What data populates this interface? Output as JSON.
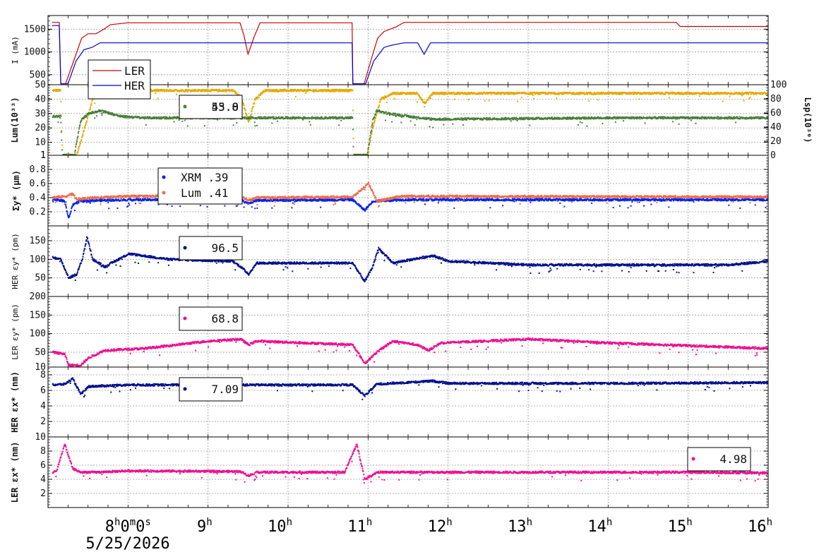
{
  "chart_data": [
    {
      "type": "line",
      "panel": "current",
      "ylabel": "I (mA)",
      "ylim": [
        280,
        1800
      ],
      "yticks": [
        500,
        1000,
        1500
      ],
      "grid": true,
      "legend": {
        "placement": "bottom-left",
        "entries": [
          "LER",
          "HER"
        ]
      },
      "series": [
        {
          "name": "LER",
          "color": "#cc0000",
          "points": [
            [
              7.05,
              1650
            ],
            [
              7.14,
              1650
            ],
            [
              7.16,
              300
            ],
            [
              7.22,
              300
            ],
            [
              7.32,
              800
            ],
            [
              7.42,
              1300
            ],
            [
              7.5,
              1400
            ],
            [
              7.6,
              1400
            ],
            [
              7.7,
              1500
            ],
            [
              7.78,
              1600
            ],
            [
              8.0,
              1640
            ],
            [
              9.4,
              1640
            ],
            [
              9.45,
              1350
            ],
            [
              9.5,
              950
            ],
            [
              9.58,
              1350
            ],
            [
              9.65,
              1640
            ],
            [
              10.8,
              1640
            ],
            [
              10.81,
              300
            ],
            [
              10.95,
              300
            ],
            [
              11.05,
              900
            ],
            [
              11.12,
              1300
            ],
            [
              11.2,
              1450
            ],
            [
              11.35,
              1550
            ],
            [
              11.45,
              1650
            ],
            [
              14.85,
              1650
            ],
            [
              14.9,
              1560
            ],
            [
              16.0,
              1560
            ]
          ]
        },
        {
          "name": "HER",
          "color": "#0000cc",
          "points": [
            [
              7.05,
              1580
            ],
            [
              7.14,
              1580
            ],
            [
              7.16,
              300
            ],
            [
              7.25,
              300
            ],
            [
              7.35,
              800
            ],
            [
              7.45,
              1050
            ],
            [
              7.55,
              1100
            ],
            [
              7.65,
              1200
            ],
            [
              10.8,
              1200
            ],
            [
              10.81,
              300
            ],
            [
              10.97,
              300
            ],
            [
              11.07,
              800
            ],
            [
              11.2,
              1100
            ],
            [
              11.3,
              1150
            ],
            [
              11.45,
              1200
            ],
            [
              11.62,
              1200
            ],
            [
              11.7,
              950
            ],
            [
              11.78,
              1200
            ],
            [
              16.0,
              1200
            ]
          ]
        }
      ]
    },
    {
      "type": "scatter",
      "panel": "luminosity",
      "ylabel": "Lum(10³³)",
      "ylabel_right": "Lsp(10³⁰)",
      "ylim": [
        1,
        50
      ],
      "yticks": [
        1,
        10,
        20,
        30,
        40,
        50
      ],
      "y2lim": [
        0,
        100
      ],
      "y2ticks": [
        0,
        20,
        40,
        60,
        80,
        100
      ],
      "grid": true,
      "legend": {
        "placement": "top-center",
        "values": [
          "55.0",
          "43.8"
        ]
      },
      "series": [
        {
          "color": "#e6a800",
          "points": [
            [
              7.05,
              46
            ],
            [
              7.15,
              46
            ],
            [
              7.17,
              1
            ],
            [
              7.35,
              1
            ],
            [
              7.45,
              20
            ],
            [
              7.55,
              40
            ],
            [
              7.7,
              45
            ],
            [
              8.0,
              46
            ],
            [
              9.3,
              46
            ],
            [
              9.4,
              42
            ],
            [
              9.5,
              24
            ],
            [
              9.58,
              40
            ],
            [
              9.7,
              46
            ],
            [
              10.8,
              46
            ],
            [
              10.81,
              1
            ],
            [
              10.98,
              1
            ],
            [
              11.05,
              20
            ],
            [
              11.15,
              40
            ],
            [
              11.3,
              44
            ],
            [
              11.6,
              44
            ],
            [
              11.7,
              37
            ],
            [
              11.8,
              44
            ],
            [
              16.0,
              44
            ]
          ]
        },
        {
          "color": "#4a7f3a",
          "points": [
            [
              7.05,
              28
            ],
            [
              7.15,
              28
            ],
            [
              7.17,
              1
            ],
            [
              7.32,
              1
            ],
            [
              7.4,
              25
            ],
            [
              7.5,
              30
            ],
            [
              7.65,
              32
            ],
            [
              7.9,
              28
            ],
            [
              8.2,
              27
            ],
            [
              10.8,
              27
            ],
            [
              10.81,
              1
            ],
            [
              10.98,
              1
            ],
            [
              11.05,
              25
            ],
            [
              11.1,
              32
            ],
            [
              11.25,
              30
            ],
            [
              11.5,
              28
            ],
            [
              11.8,
              26
            ],
            [
              14.0,
              27
            ],
            [
              16.0,
              27
            ]
          ]
        }
      ]
    },
    {
      "type": "scatter",
      "panel": "beam-size",
      "ylabel": "Σy* (μm)",
      "ylim": [
        0.0,
        1.0
      ],
      "yticks": [
        0.2,
        0.4,
        0.6,
        0.8,
        1.0
      ],
      "grid": true,
      "legend": {
        "placement": "top-center",
        "entries": [
          "XRM  .39",
          "Lum  .41"
        ]
      },
      "series": [
        {
          "name": "XRM",
          "color": "#0022ee",
          "points": [
            [
              7.05,
              0.38
            ],
            [
              7.2,
              0.35
            ],
            [
              7.25,
              0.1
            ],
            [
              7.3,
              0.3
            ],
            [
              7.4,
              0.35
            ],
            [
              7.6,
              0.36
            ],
            [
              8.0,
              0.37
            ],
            [
              9.4,
              0.37
            ],
            [
              9.5,
              0.32
            ],
            [
              9.6,
              0.36
            ],
            [
              10.8,
              0.37
            ],
            [
              10.95,
              0.22
            ],
            [
              11.05,
              0.35
            ],
            [
              11.4,
              0.37
            ],
            [
              16.0,
              0.37
            ]
          ]
        },
        {
          "name": "Lum",
          "color": "#f06a4a",
          "points": [
            [
              7.05,
              0.4
            ],
            [
              7.2,
              0.42
            ],
            [
              7.3,
              0.45
            ],
            [
              7.35,
              0.38
            ],
            [
              7.6,
              0.4
            ],
            [
              8.0,
              0.42
            ],
            [
              9.4,
              0.42
            ],
            [
              9.5,
              0.36
            ],
            [
              9.6,
              0.4
            ],
            [
              10.8,
              0.41
            ],
            [
              11.0,
              0.6
            ],
            [
              11.1,
              0.35
            ],
            [
              11.4,
              0.42
            ],
            [
              16.0,
              0.41
            ]
          ]
        }
      ]
    },
    {
      "type": "scatter",
      "panel": "her-emittance-y",
      "ylabel": "HER εy* (pm)",
      "ylim": [
        0,
        190
      ],
      "yticks": [
        50,
        100,
        150
      ],
      "grid": true,
      "legend": {
        "placement": "top-center",
        "values": [
          "96.5"
        ]
      },
      "series": [
        {
          "color": "#00108c",
          "points": [
            [
              7.05,
              105
            ],
            [
              7.15,
              100
            ],
            [
              7.25,
              50
            ],
            [
              7.35,
              60
            ],
            [
              7.42,
              100
            ],
            [
              7.48,
              160
            ],
            [
              7.55,
              100
            ],
            [
              7.7,
              80
            ],
            [
              8.0,
              115
            ],
            [
              8.5,
              100
            ],
            [
              9.3,
              95
            ],
            [
              9.4,
              80
            ],
            [
              9.5,
              60
            ],
            [
              9.6,
              90
            ],
            [
              10.8,
              90
            ],
            [
              10.95,
              40
            ],
            [
              11.05,
              80
            ],
            [
              11.12,
              130
            ],
            [
              11.3,
              90
            ],
            [
              11.8,
              110
            ],
            [
              12.0,
              95
            ],
            [
              13.0,
              85
            ],
            [
              14.5,
              85
            ],
            [
              15.5,
              85
            ],
            [
              16.0,
              95
            ]
          ]
        }
      ]
    },
    {
      "type": "scatter",
      "panel": "ler-emittance-y",
      "ylabel": "LER εy* (pm)",
      "ylim": [
        10,
        200
      ],
      "yticks": [
        10,
        50,
        100,
        150,
        200
      ],
      "grid": true,
      "legend": {
        "placement": "top-center",
        "values": [
          "68.8"
        ]
      },
      "series": [
        {
          "color": "#ee1090",
          "points": [
            [
              7.05,
              50
            ],
            [
              7.2,
              45
            ],
            [
              7.25,
              15
            ],
            [
              7.4,
              15
            ],
            [
              7.5,
              35
            ],
            [
              7.7,
              55
            ],
            [
              8.2,
              60
            ],
            [
              9.0,
              80
            ],
            [
              9.4,
              85
            ],
            [
              9.5,
              70
            ],
            [
              9.6,
              80
            ],
            [
              10.8,
              70
            ],
            [
              10.95,
              20
            ],
            [
              11.1,
              50
            ],
            [
              11.3,
              80
            ],
            [
              11.6,
              70
            ],
            [
              11.75,
              55
            ],
            [
              11.9,
              75
            ],
            [
              13.0,
              85
            ],
            [
              14.0,
              75
            ],
            [
              16.0,
              60
            ]
          ]
        }
      ]
    },
    {
      "type": "scatter",
      "panel": "her-emittance-x",
      "ylabel": "HER εx* (nm)",
      "ylim": [
        0,
        9
      ],
      "yticks": [
        2,
        4,
        6,
        8
      ],
      "grid": true,
      "legend": {
        "placement": "top-center",
        "values": [
          "7.09"
        ]
      },
      "series": [
        {
          "color": "#00108c",
          "points": [
            [
              7.05,
              6.7
            ],
            [
              7.2,
              6.8
            ],
            [
              7.3,
              7.5
            ],
            [
              7.4,
              5.5
            ],
            [
              7.5,
              6.5
            ],
            [
              8.0,
              6.7
            ],
            [
              10.8,
              6.7
            ],
            [
              10.95,
              5.3
            ],
            [
              11.1,
              6.8
            ],
            [
              11.8,
              7.2
            ],
            [
              12.0,
              6.9
            ],
            [
              14.0,
              6.9
            ],
            [
              16.0,
              7.0
            ]
          ]
        }
      ]
    },
    {
      "type": "scatter",
      "panel": "ler-emittance-x",
      "ylabel": "LER εx* (nm)",
      "ylim": [
        0,
        10
      ],
      "yticks": [
        2,
        4,
        6,
        8,
        10
      ],
      "grid": true,
      "legend": {
        "placement": "right",
        "values": [
          "4.98"
        ]
      },
      "series": [
        {
          "color": "#ee1090",
          "points": [
            [
              7.05,
              5.0
            ],
            [
              7.1,
              5.2
            ],
            [
              7.2,
              9.0
            ],
            [
              7.3,
              5.5
            ],
            [
              7.4,
              5.0
            ],
            [
              7.6,
              5.0
            ],
            [
              8.0,
              5.2
            ],
            [
              9.4,
              5.1
            ],
            [
              9.5,
              4.5
            ],
            [
              9.6,
              5.0
            ],
            [
              10.7,
              5.0
            ],
            [
              10.85,
              9.0
            ],
            [
              10.95,
              4.0
            ],
            [
              11.1,
              5.0
            ],
            [
              13.0,
              5.0
            ],
            [
              15.0,
              5.0
            ],
            [
              16.0,
              4.9
            ]
          ]
        }
      ]
    }
  ],
  "xaxis": {
    "xlim": [
      7.0,
      16.0
    ],
    "ticks": [
      {
        "t": 8,
        "label": "8",
        "sup": "h",
        "extra": "0",
        "sup2": "m",
        "extra2": "0",
        "sup3": "s"
      },
      {
        "t": 9,
        "label": "9",
        "sup": "h"
      },
      {
        "t": 10,
        "label": "10",
        "sup": "h"
      },
      {
        "t": 11,
        "label": "11",
        "sup": "h"
      },
      {
        "t": 12,
        "label": "12",
        "sup": "h"
      },
      {
        "t": 13,
        "label": "13",
        "sup": "h"
      },
      {
        "t": 14,
        "label": "14",
        "sup": "h"
      },
      {
        "t": 15,
        "label": "15",
        "sup": "h"
      },
      {
        "t": 16,
        "label": "16",
        "sup": "h"
      }
    ],
    "date": "5/25/2026"
  }
}
